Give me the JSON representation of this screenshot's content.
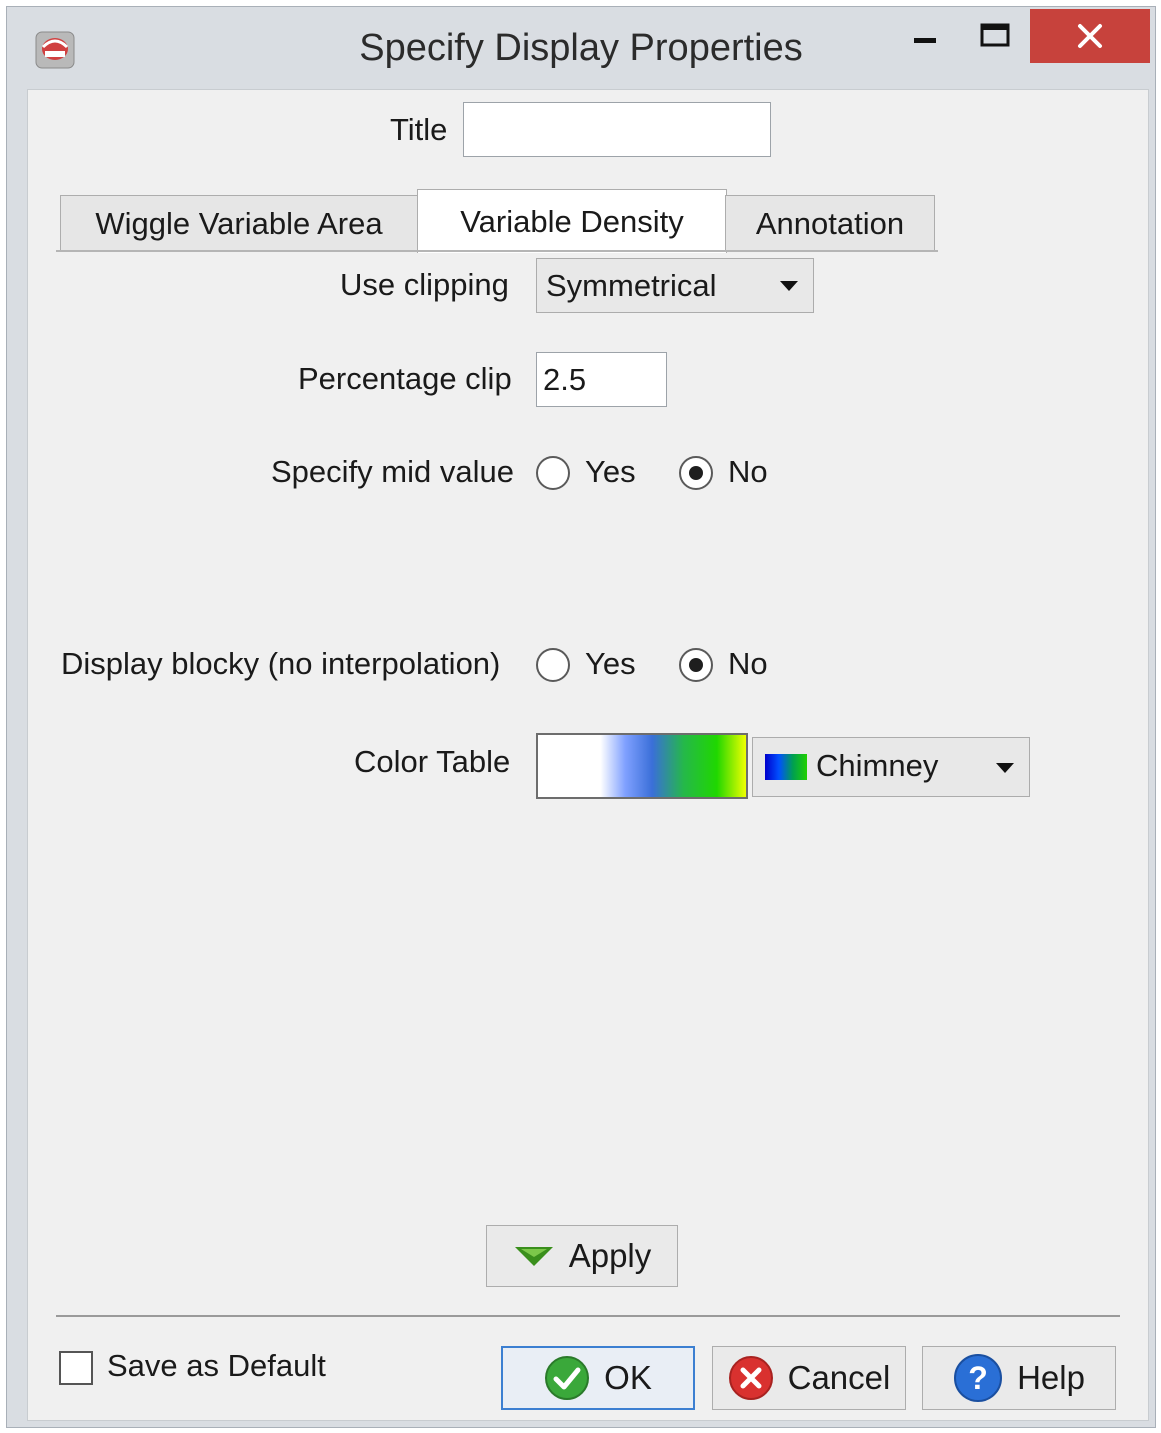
{
  "window": {
    "title": "Specify Display Properties"
  },
  "title_field": {
    "label": "Title",
    "value": ""
  },
  "tabs": [
    {
      "label": "Wiggle Variable Area",
      "active": false
    },
    {
      "label": "Variable Density",
      "active": true
    },
    {
      "label": "Annotation",
      "active": false
    }
  ],
  "clipping": {
    "label": "Use clipping",
    "selected": "Symmetrical"
  },
  "percentage_clip": {
    "label": "Percentage clip",
    "value": "2.5"
  },
  "mid_value": {
    "label": "Specify mid value",
    "yes_label": "Yes",
    "no_label": "No",
    "selected": "No"
  },
  "blocky": {
    "label": "Display blocky (no interpolation)",
    "yes_label": "Yes",
    "no_label": "No",
    "selected": "No"
  },
  "color_table": {
    "label": "Color Table",
    "selected": "Chimney",
    "gradient_colors": [
      "#ffffff",
      "#ffffff",
      "#7fa0ff",
      "#3a6fd8",
      "#25b84a",
      "#20d700",
      "#f0ff00"
    ]
  },
  "buttons": {
    "apply": "Apply",
    "ok": "OK",
    "cancel": "Cancel",
    "help": "Help"
  },
  "save_default": {
    "label": "Save as Default",
    "checked": false
  },
  "colors": {
    "close_button": "#c7423c",
    "ok_border": "#3c7fd1",
    "ok_icon": "#3aa83a",
    "cancel_icon": "#d9312f",
    "help_icon": "#2a6fd6",
    "apply_icon": "#3a8f1c"
  }
}
